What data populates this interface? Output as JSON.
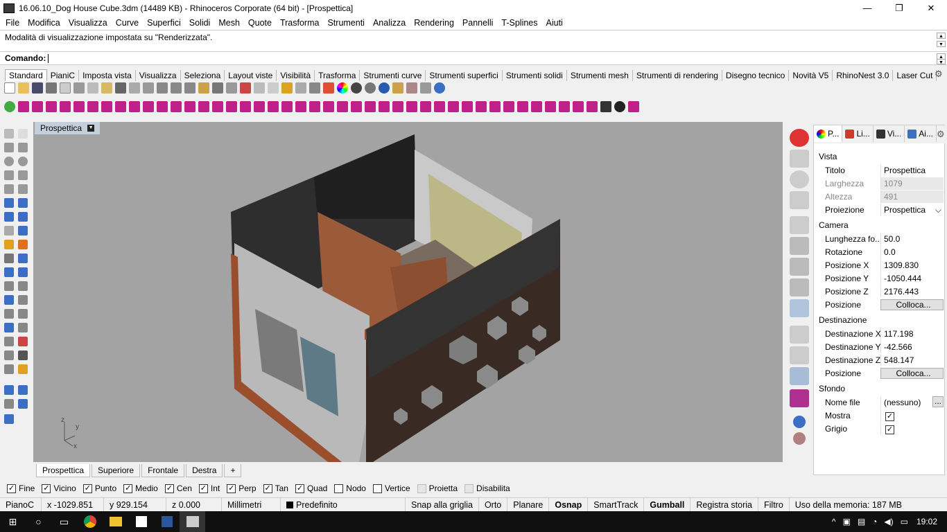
{
  "window": {
    "title": "16.06.10_Dog House Cube.3dm (14489 KB) - Rhinoceros Corporate (64 bit) - [Prospettica]",
    "minimize": "—",
    "restore": "❐",
    "close": "✕"
  },
  "menu": [
    "File",
    "Modifica",
    "Visualizza",
    "Curve",
    "Superfici",
    "Solidi",
    "Mesh",
    "Quote",
    "Trasforma",
    "Strumenti",
    "Analizza",
    "Rendering",
    "Pannelli",
    "T-Splines",
    "Aiuti"
  ],
  "command": {
    "history": "Modalità di visualizzazione impostata su \"Renderizzata\".",
    "prompt": "Comando:"
  },
  "toolbar_tabs": [
    "Standard",
    "PianiC",
    "Imposta vista",
    "Visualizza",
    "Seleziona",
    "Layout viste",
    "Visibilità",
    "Trasforma",
    "Strumenti curve",
    "Strumenti superfici",
    "Strumenti solidi",
    "Strumenti mesh",
    "Strumenti di rendering",
    "Disegno tecnico",
    "Novità V5",
    "RhinoNest 3.0",
    "Laser Cut"
  ],
  "viewport": {
    "name": "Prospettica",
    "axes": {
      "z": "z",
      "y": "y",
      "x": "x"
    }
  },
  "view_tabs": [
    "Prospettica",
    "Superiore",
    "Frontale",
    "Destra"
  ],
  "view_tab_add": "+",
  "osnap": [
    {
      "label": "Fine",
      "checked": true
    },
    {
      "label": "Vicino",
      "checked": true
    },
    {
      "label": "Punto",
      "checked": true
    },
    {
      "label": "Medio",
      "checked": true
    },
    {
      "label": "Cen",
      "checked": true
    },
    {
      "label": "Int",
      "checked": true
    },
    {
      "label": "Perp",
      "checked": true
    },
    {
      "label": "Tan",
      "checked": true
    },
    {
      "label": "Quad",
      "checked": true
    },
    {
      "label": "Nodo",
      "checked": false
    },
    {
      "label": "Vertice",
      "checked": false
    },
    {
      "label": "Proietta",
      "checked": false,
      "disabled": true
    },
    {
      "label": "Disabilita",
      "checked": false,
      "disabled": true
    }
  ],
  "status": {
    "plane": "PianoC",
    "x": "x -1029.851",
    "y": "y 929.154",
    "z": "z 0.000",
    "units": "Millimetri",
    "layer": "Predefinito",
    "snap_grid": "Snap alla griglia",
    "orto": "Orto",
    "planare": "Planare",
    "osnap": "Osnap",
    "smarttrack": "SmartTrack",
    "gumball": "Gumball",
    "history": "Registra storia",
    "filtro": "Filtro",
    "memory": "Uso della memoria: 187 MB"
  },
  "panel": {
    "tabs": [
      "P...",
      "Li...",
      "Vi...",
      "Ai..."
    ],
    "sections": {
      "vista": "Vista",
      "camera": "Camera",
      "destinazione": "Destinazione",
      "sfondo": "Sfondo"
    },
    "vista_rows": [
      {
        "label": "Titolo",
        "value": "Prospettica"
      },
      {
        "label": "Larghezza",
        "value": "1079"
      },
      {
        "label": "Altezza",
        "value": "491"
      },
      {
        "label": "Proiezione",
        "value": "Prospettica"
      }
    ],
    "camera_rows": [
      {
        "label": "Lunghezza fo...",
        "value": "50.0"
      },
      {
        "label": "Rotazione",
        "value": "0.0"
      },
      {
        "label": "Posizione X",
        "value": "1309.830"
      },
      {
        "label": "Posizione Y",
        "value": "-1050.444"
      },
      {
        "label": "Posizione Z",
        "value": "2176.443"
      },
      {
        "label": "Posizione",
        "value": "Colloca..."
      }
    ],
    "dest_rows": [
      {
        "label": "Destinazione X",
        "value": "117.198"
      },
      {
        "label": "Destinazione Y",
        "value": "-42.566"
      },
      {
        "label": "Destinazione Z",
        "value": "548.147"
      },
      {
        "label": "Posizione",
        "value": "Colloca..."
      }
    ],
    "sfondo_rows": [
      {
        "label": "Nome file",
        "value": "(nessuno)"
      },
      {
        "label": "Mostra",
        "value": "✓"
      },
      {
        "label": "Grigio",
        "value": "✓"
      }
    ],
    "browse": "..."
  },
  "taskbar": {
    "time": "19:02"
  }
}
